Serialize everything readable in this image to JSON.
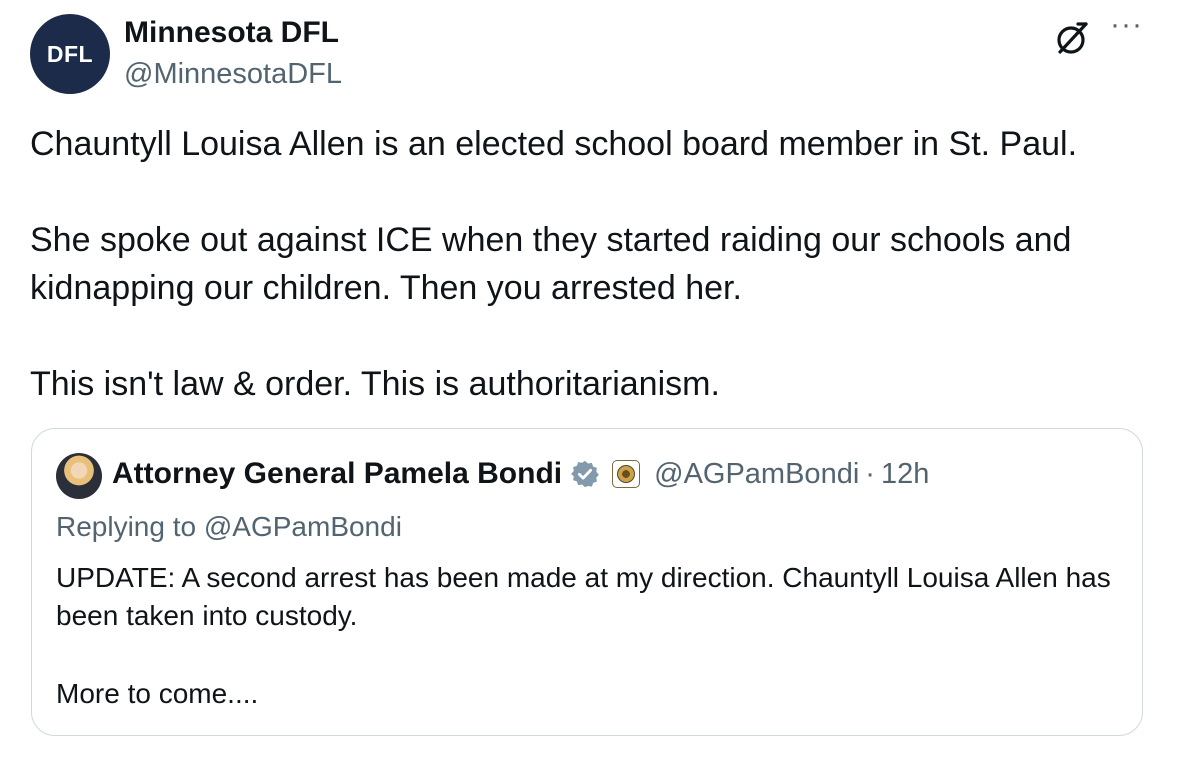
{
  "post": {
    "author": {
      "avatar_text": "DFL",
      "display_name": "Minnesota DFL",
      "handle": "@MinnesotaDFL"
    },
    "actions": {
      "grok_icon": "grok-icon",
      "more_label": "···"
    },
    "paragraphs": [
      "Chauntyll Louisa Allen is an elected school board member in St. Paul.",
      "She spoke out against ICE when they started raiding our schools and kidnapping our children. Then you arrested her.",
      "This isn't law & order. This is authoritarianism."
    ]
  },
  "quote": {
    "author": {
      "display_name": "Attorney General Pamela Bondi",
      "handle": "@AGPamBondi",
      "separator": "·",
      "time": "12h",
      "verified": true,
      "affiliate_badge": "doj-seal-icon"
    },
    "replying_to": "Replying to @AGPamBondi",
    "paragraphs": [
      "UPDATE: A second arrest has been made at my direction. Chauntyll Louisa Allen has been taken into custody.",
      "More to come...."
    ]
  },
  "colors": {
    "text_primary": "#0f1419",
    "text_secondary": "#536471",
    "border": "#cfd9de",
    "verified_badge": "#829aab",
    "avatar_bg": "#1d2b4a"
  }
}
